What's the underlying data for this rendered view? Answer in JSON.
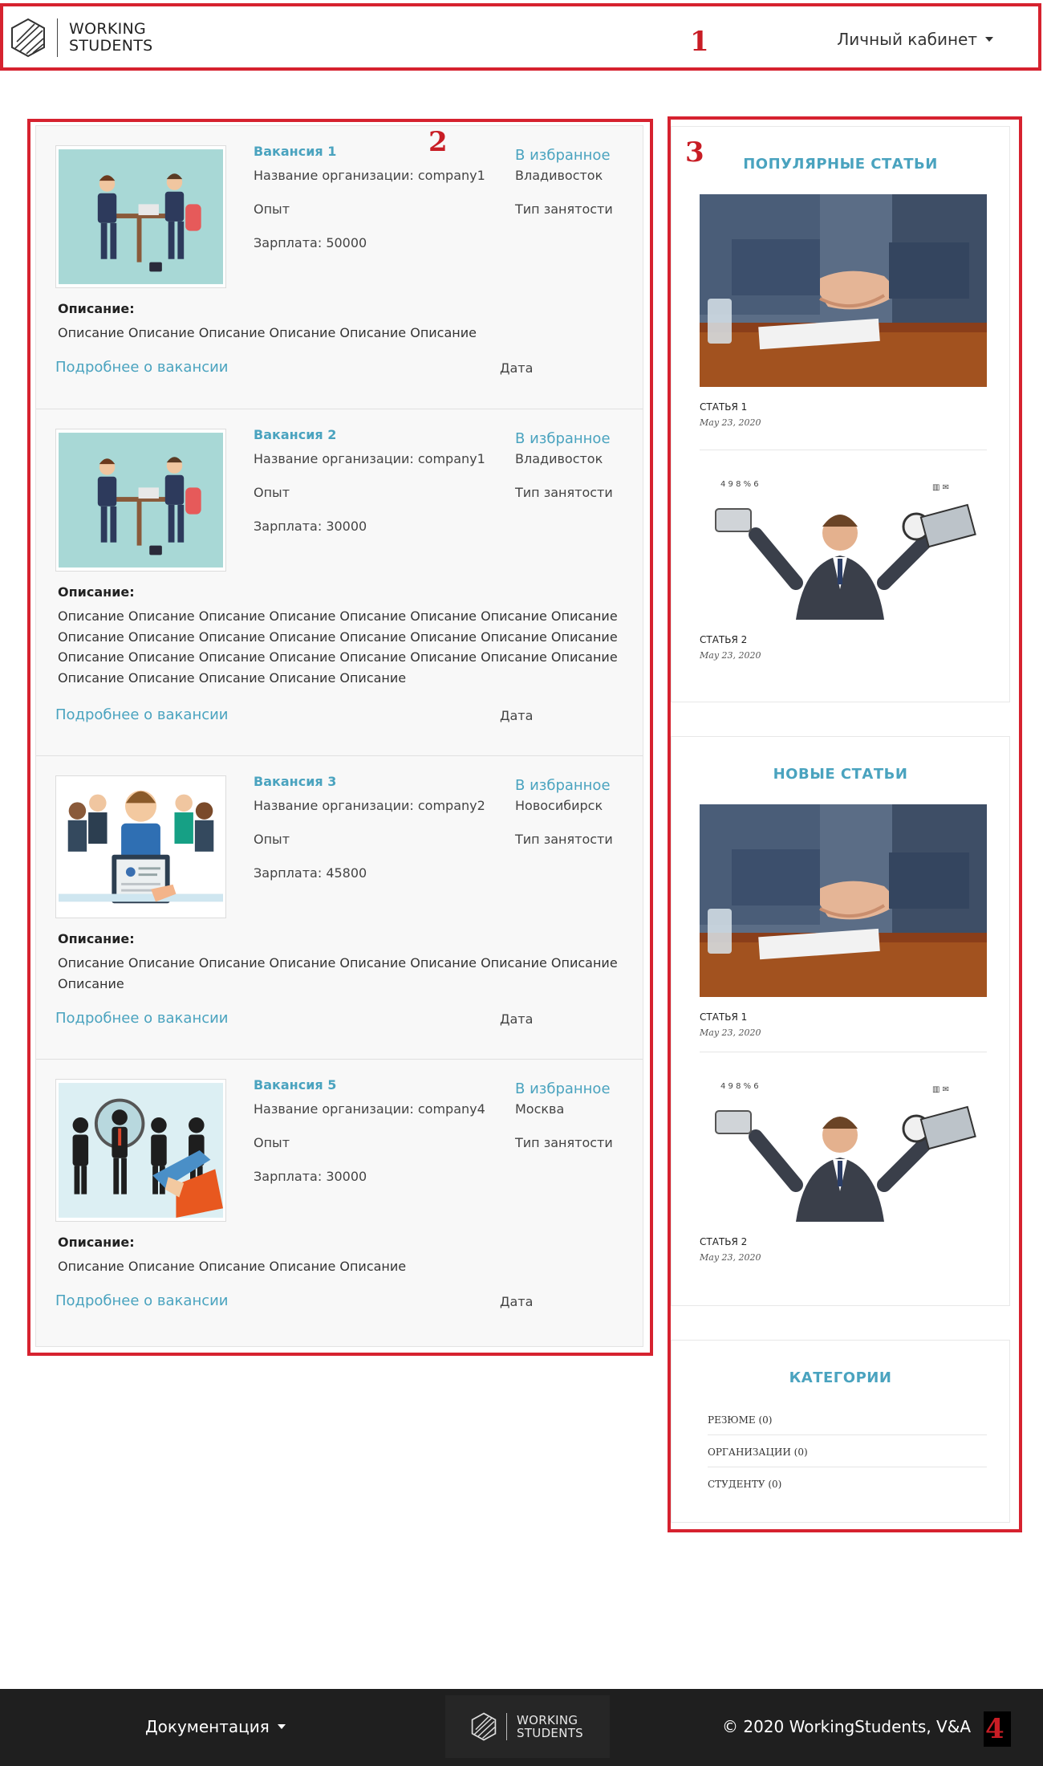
{
  "header": {
    "brand_line1": "WORKING",
    "brand_line2": "STUDENTS",
    "account_label": "Личный кабинет"
  },
  "annotations": [
    "1",
    "2",
    "3",
    "4"
  ],
  "vacancies": [
    {
      "title": "Вакансия 1",
      "organization": "Название организации: company1",
      "experience": "Опыт",
      "salary": "Зарплата: 50000",
      "favorite": "В избранное",
      "city": "Владивосток",
      "employment_type": "Тип занятости",
      "description_label": "Описание:",
      "description": "Описание Описание Описание Описание Описание Описание",
      "more_link": "Подробнее о вакансии",
      "date": "Дата",
      "image": "interview-illustration"
    },
    {
      "title": "Вакансия 2",
      "organization": "Название организации: company1",
      "experience": "Опыт",
      "salary": "Зарплата: 30000",
      "favorite": "В избранное",
      "city": "Владивосток",
      "employment_type": "Тип занятости",
      "description_label": "Описание:",
      "description": "Описание Описание Описание Описание Описание Описание Описание Описание Описание Описание Описание Описание Описание Описание Описание Описание Описание Описание Описание Описание Описание Описание Описание Описание Описание Описание Описание Описание Описание",
      "more_link": "Подробнее о вакансии",
      "date": "Дата",
      "image": "interview-illustration"
    },
    {
      "title": "Вакансия 3",
      "organization": "Название организации: company2",
      "experience": "Опыт",
      "salary": "Зарплата: 45800",
      "favorite": "В избранное",
      "city": "Новосибирск",
      "employment_type": "Тип занятости",
      "description_label": "Описание:",
      "description": "Описание Описание Описание Описание Описание Описание Описание Описание Описание",
      "more_link": "Подробнее о вакансии",
      "date": "Дата",
      "image": "team-resume-illustration"
    },
    {
      "title": "Вакансия 5",
      "organization": "Название организации: company4",
      "experience": "Опыт",
      "salary": "Зарплата: 30000",
      "favorite": "В избранное",
      "city": "Москва",
      "employment_type": "Тип занятости",
      "description_label": "Описание:",
      "description": "Описание Описание Описание Описание Описание",
      "more_link": "Подробнее о вакансии",
      "date": "Дата",
      "image": "recruitment-magnifier-illustration"
    }
  ],
  "popular_articles": {
    "title": "ПОПУЛЯРНЫЕ СТАТЬИ",
    "items": [
      {
        "title": "СТАТЬЯ 1",
        "date": "May 23, 2020",
        "image": "handshake-photo"
      },
      {
        "title": "СТАТЬЯ 2",
        "date": "May 23, 2020",
        "image": "multitasking-businessman-photo"
      }
    ]
  },
  "new_articles": {
    "title": "НОВЫЕ СТАТЬИ",
    "items": [
      {
        "title": "СТАТЬЯ 1",
        "date": "May 23, 2020",
        "image": "handshake-photo"
      },
      {
        "title": "СТАТЬЯ 2",
        "date": "May 23, 2020",
        "image": "multitasking-businessman-photo"
      }
    ]
  },
  "categories": {
    "title": "КАТЕГОРИИ",
    "items": [
      "РЕЗЮМЕ (0)",
      "ОРГАНИЗАЦИИ (0)",
      "СТУДЕНТУ (0)"
    ]
  },
  "footer": {
    "docs_label": "Документация",
    "brand_line1": "WORKING",
    "brand_line2": "STUDENTS",
    "copyright": "© 2020 WorkingStudents, V&A"
  },
  "colors": {
    "accent": "#4aa3bf",
    "annotation_red": "#d6222f",
    "footer_bg": "#1f1f1f"
  }
}
